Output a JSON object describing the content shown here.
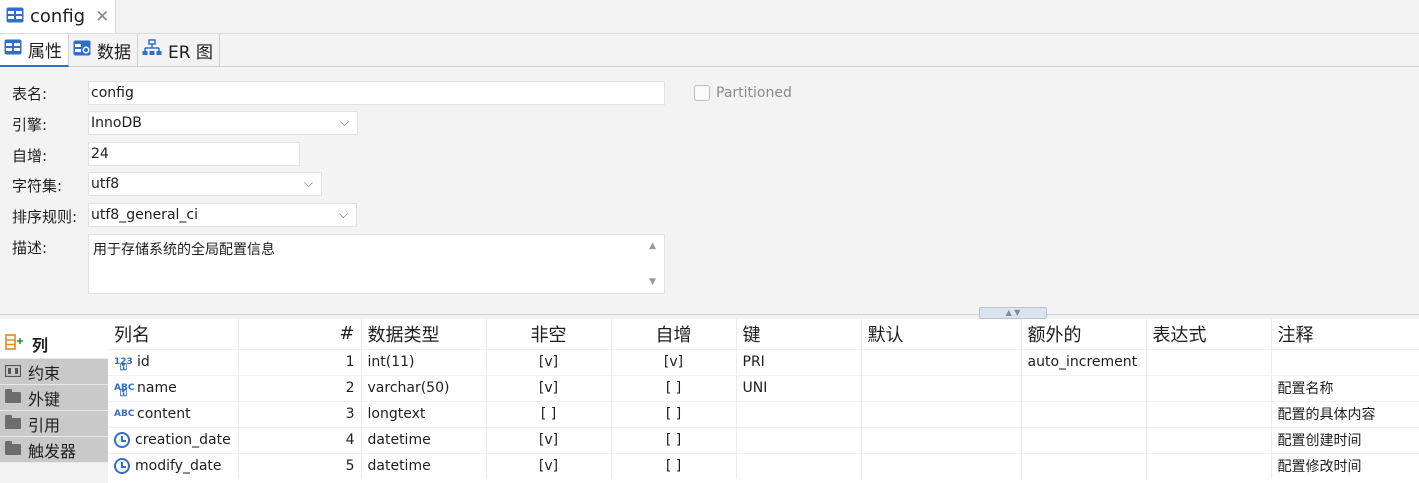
{
  "editor_tab": {
    "title": "config"
  },
  "subtabs": [
    {
      "label": "属性",
      "icon": "table-grid-icon"
    },
    {
      "label": "数据",
      "icon": "data-grid-icon"
    },
    {
      "label": "ER 图",
      "icon": "er-diagram-icon"
    }
  ],
  "properties": {
    "table_name_label": "表名:",
    "table_name": "config",
    "engine_label": "引擎:",
    "engine": "InnoDB",
    "auto_increment_label": "自增:",
    "auto_increment": "24",
    "charset_label": "字符集:",
    "charset": "utf8",
    "collation_label": "排序规则:",
    "collation": "utf8_general_ci",
    "description_label": "描述:",
    "description": "用于存储系统的全局配置信息",
    "partitioned_label": "Partitioned",
    "partitioned_checked": false
  },
  "side_nav": [
    {
      "label": "列",
      "active": true,
      "icon": "add-column-icon"
    },
    {
      "label": "约束",
      "active": false,
      "icon": "constraint-icon"
    },
    {
      "label": "外键",
      "active": false,
      "icon": "folder-icon"
    },
    {
      "label": "引用",
      "active": false,
      "icon": "folder-icon"
    },
    {
      "label": "触发器",
      "active": false,
      "icon": "folder-icon"
    }
  ],
  "columns_table": {
    "headers": [
      "列名",
      "#",
      "数据类型",
      "非空",
      "自增",
      "键",
      "默认",
      "额外的",
      "表达式",
      "注释"
    ],
    "rows": [
      {
        "icon": "numeric-key-icon",
        "name": "id",
        "index": "1",
        "type": "int(11)",
        "not_null": "[v]",
        "auto_inc": "[v]",
        "key": "PRI",
        "default": "",
        "extra": "auto_increment",
        "expression": "",
        "comment": ""
      },
      {
        "icon": "text-key-icon",
        "name": "name",
        "index": "2",
        "type": "varchar(50)",
        "not_null": "[v]",
        "auto_inc": "[ ]",
        "key": "UNI",
        "default": "",
        "extra": "",
        "expression": "",
        "comment": "配置名称"
      },
      {
        "icon": "text-icon",
        "name": "content",
        "index": "3",
        "type": "longtext",
        "not_null": "[ ]",
        "auto_inc": "[ ]",
        "key": "",
        "default": "",
        "extra": "",
        "expression": "",
        "comment": "配置的具体内容"
      },
      {
        "icon": "clock-icon",
        "name": "creation_date",
        "index": "4",
        "type": "datetime",
        "not_null": "[v]",
        "auto_inc": "[ ]",
        "key": "",
        "default": "",
        "extra": "",
        "expression": "",
        "comment": "配置创建时间"
      },
      {
        "icon": "clock-icon",
        "name": "modify_date",
        "index": "5",
        "type": "datetime",
        "not_null": "[v]",
        "auto_inc": "[ ]",
        "key": "",
        "default": "",
        "extra": "",
        "expression": "",
        "comment": "配置修改时间"
      }
    ]
  },
  "colors": {
    "accent": "#2f6fc7",
    "nav_inactive": "#c9c9c9"
  }
}
